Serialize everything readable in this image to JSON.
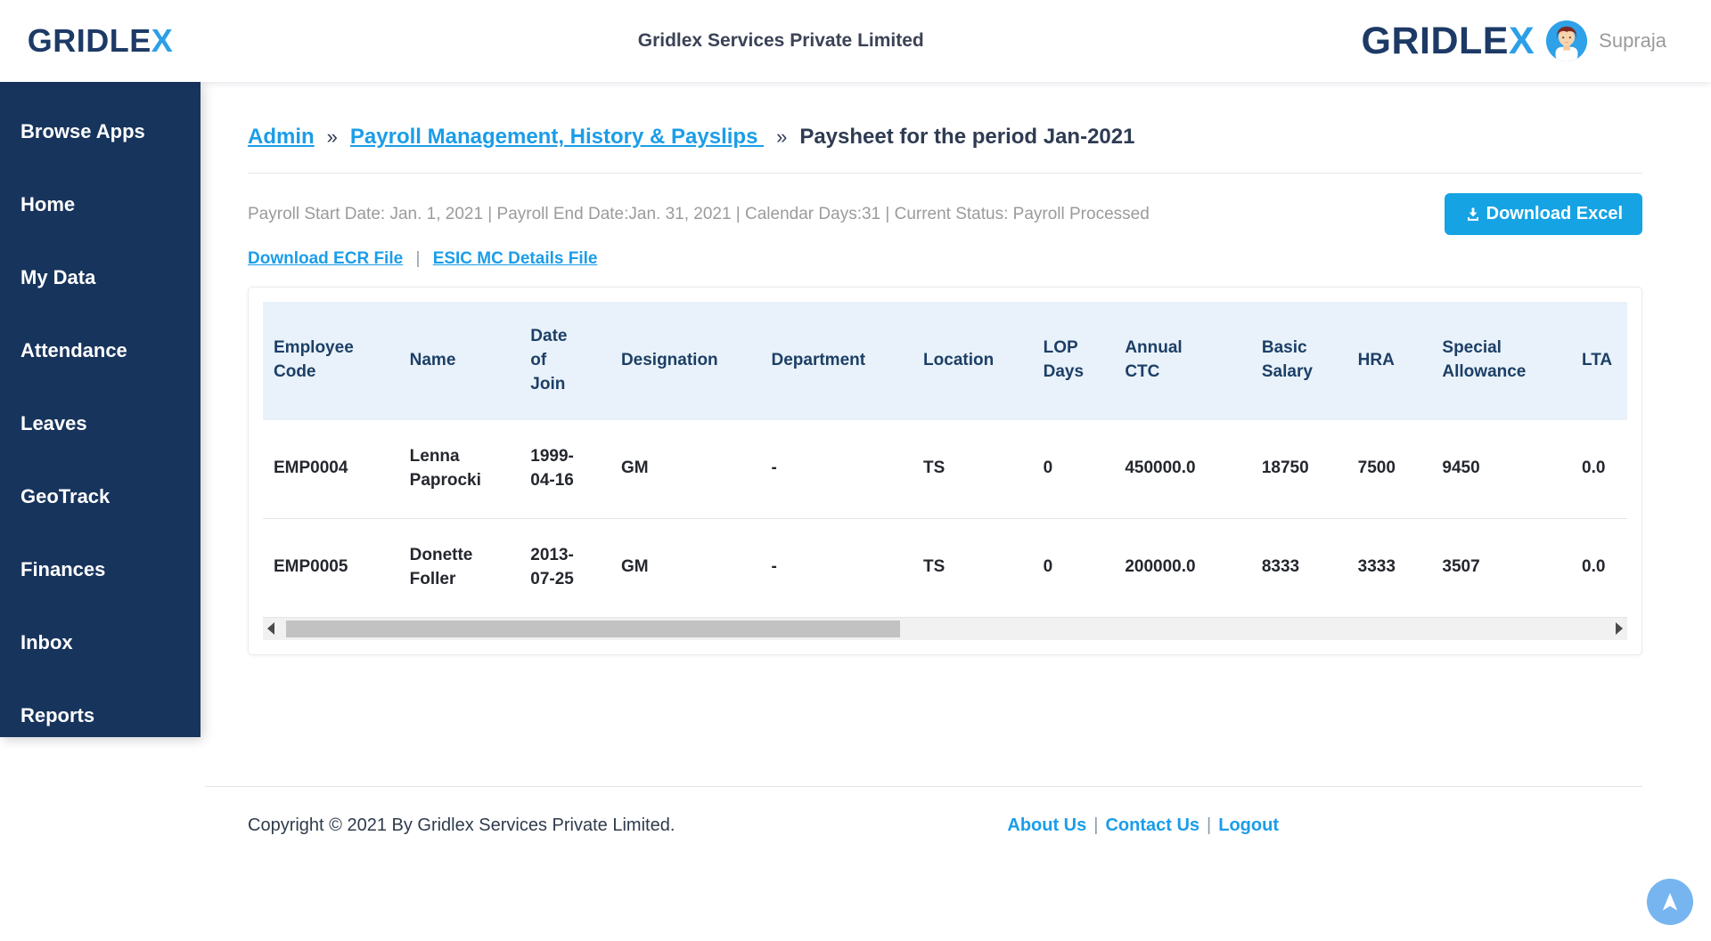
{
  "header": {
    "brand_prefix": "GRIDLE",
    "brand_suffix": "X",
    "company_title": "Gridlex Services Private Limited",
    "user_name": "Supraja"
  },
  "sidebar": {
    "items": [
      "Browse Apps",
      "Home",
      "My Data",
      "Attendance",
      "Leaves",
      "GeoTrack",
      "Finances",
      "Inbox",
      "Reports"
    ]
  },
  "breadcrumb": {
    "links": [
      "Admin",
      "Payroll Management, History & Payslips "
    ],
    "separator": "»",
    "current": "Paysheet for the period Jan-2021"
  },
  "summary": {
    "info_line": "Payroll Start Date: Jan. 1, 2021 | Payroll End Date:Jan. 31, 2021 | Calendar Days:31 | Current Status: Payroll Processed",
    "download_excel_label": "Download Excel",
    "file_links": [
      "Download ECR File",
      "ESIC MC Details File"
    ],
    "file_links_separator": "|"
  },
  "table": {
    "columns": [
      "Employee Code",
      "Name",
      "Date of Join",
      "Designation",
      "Department",
      "Location",
      "LOP Days",
      "Annual CTC",
      "Basic Salary",
      "HRA",
      "Special Allowance",
      "LTA"
    ],
    "rows": [
      [
        "EMP0004",
        "Lenna Paprocki",
        "1999-04-16",
        "GM",
        "-",
        "TS",
        "0",
        "450000.0",
        "18750",
        "7500",
        "9450",
        "0.0"
      ],
      [
        "EMP0005",
        "Donette Foller",
        "2013-07-25",
        "GM",
        "-",
        "TS",
        "0",
        "200000.0",
        "8333",
        "3333",
        "3507",
        "0.0"
      ]
    ]
  },
  "footer": {
    "copyright": "Copyright © 2021 By Gridlex Services Private Limited.",
    "links": [
      "About Us",
      "Contact Us",
      "Logout"
    ],
    "separator": "|"
  },
  "colors": {
    "sidebar_navy": "#17345c",
    "brand_navy": "#1d3a66",
    "brand_x_blue": "#2d9fe6",
    "link_blue": "#1b9de8",
    "button_blue": "#16a3e4",
    "table_header_bg": "#e9f2fa",
    "table_header_text": "#1d3f66",
    "info_gray": "#9b9b9b",
    "scroll_top_blue": "#77b5f0"
  }
}
